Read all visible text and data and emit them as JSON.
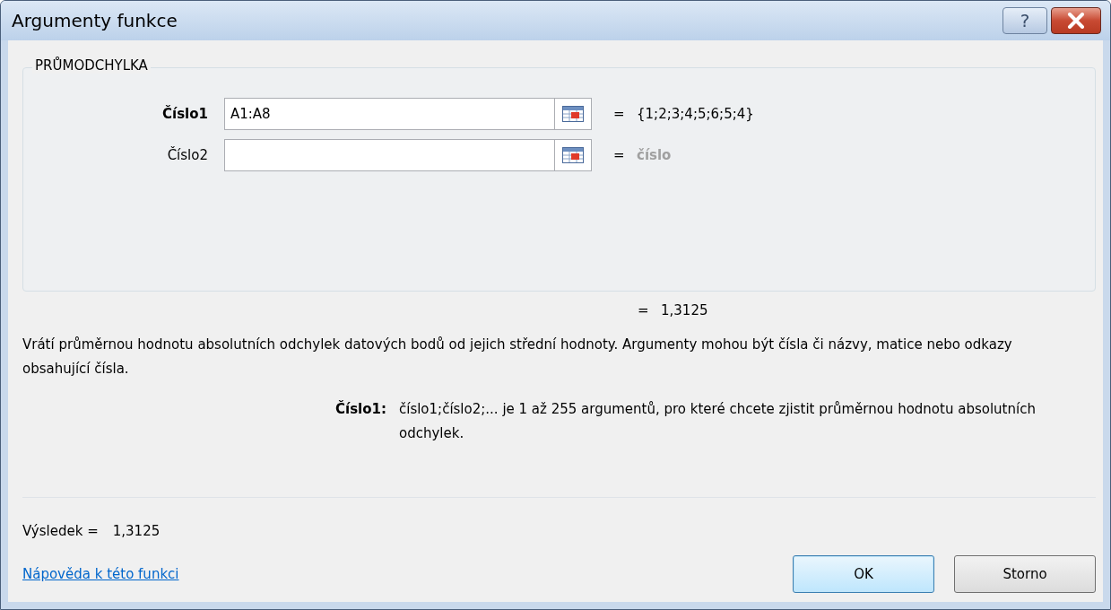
{
  "window": {
    "title": "Argumenty funkce",
    "help_button": "?"
  },
  "function_name": "PRŮMODCHYLKA",
  "arguments": [
    {
      "label": "Číslo1",
      "active": true,
      "value": "A1:A8",
      "equals": "=",
      "result": "{1;2;3;4;5;6;5;4}",
      "result_hint": false
    },
    {
      "label": "Číslo2",
      "active": false,
      "equals": "=",
      "result": "číslo",
      "result_hint": true
    }
  ],
  "formula_equals": "=",
  "formula_result": "1,3125",
  "description": "Vrátí průměrnou hodnotu absolutních odchylek datových bodů od jejich střední hodnoty. Argumenty mohou být čísla či názvy, matice nebo odkazy obsahující čísla.",
  "argument_help": {
    "label": "Číslo1:",
    "text": "číslo1;číslo2;... je 1 až 255 argumentů, pro které chcete zjistit průměrnou hodnotu absolutních odchylek."
  },
  "result": {
    "label": "Výsledek =",
    "value": "1,3125"
  },
  "help_link": "Nápověda k této funkci",
  "buttons": [
    {
      "label": "OK",
      "default": true
    },
    {
      "label": "Storno",
      "default": false
    }
  ]
}
